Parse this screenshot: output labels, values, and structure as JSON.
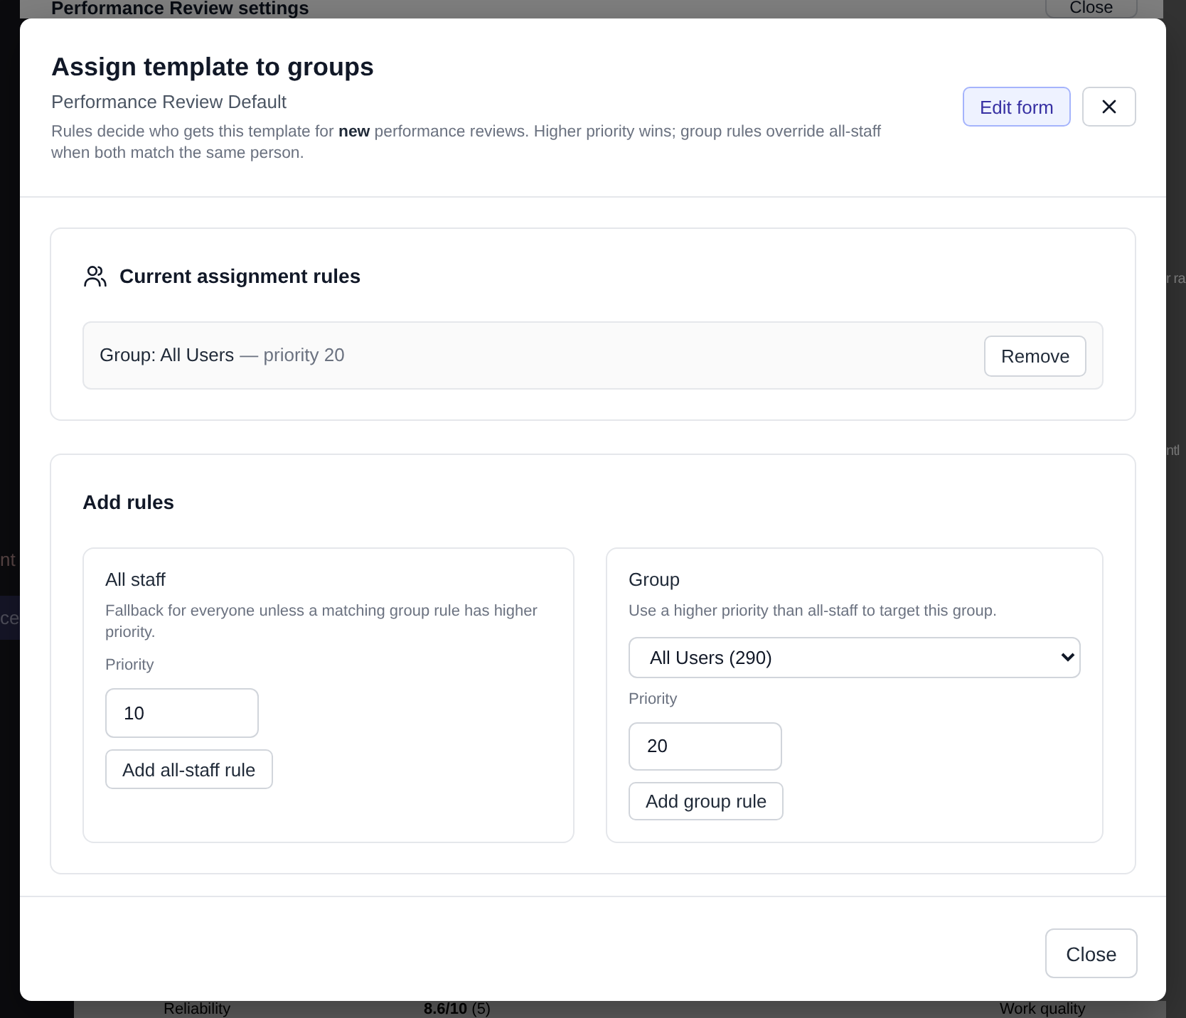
{
  "background": {
    "sidebar": {
      "items": [
        {
          "label": "nt",
          "selected": false
        },
        {
          "label": "ce",
          "selected": true
        }
      ]
    },
    "settings_panel": {
      "title": "Performance Review settings",
      "close_button": "Close"
    },
    "edge_texts": [
      "r ra",
      "ntl"
    ],
    "table_row": {
      "cells": [
        "Reliability",
        "**8.6/10** (5)",
        "Work quality"
      ]
    }
  },
  "dialog": {
    "title": "Assign template to groups",
    "subtitle": "Performance Review Default",
    "description": "Rules decide who gets this template for **new** performance reviews. Higher priority wins; group rules override all-staff when both match the same person.",
    "edit_button": "Edit form"
  },
  "current_rules": {
    "title": "Current assignment rules",
    "rules": [
      {
        "group": "Group: All Users",
        "detail": "— priority 20",
        "action": "Remove"
      }
    ]
  },
  "add_rules": {
    "title": "Add rules",
    "panels": [
      {
        "kind": "all_staff",
        "title": "All staff",
        "description": "Fallback for everyone unless a matching group rule has higher priority.",
        "priority_label": "Priority",
        "priority_value": "10",
        "button": "Add all-staff rule"
      },
      {
        "kind": "group",
        "title": "Group",
        "description": "Use a higher priority than all-staff to target this group.",
        "select_value": "All Users (290)",
        "priority_label": "Priority",
        "priority_value": "20",
        "button": "Add group rule"
      }
    ]
  },
  "footer": {
    "close_button": "Close"
  }
}
